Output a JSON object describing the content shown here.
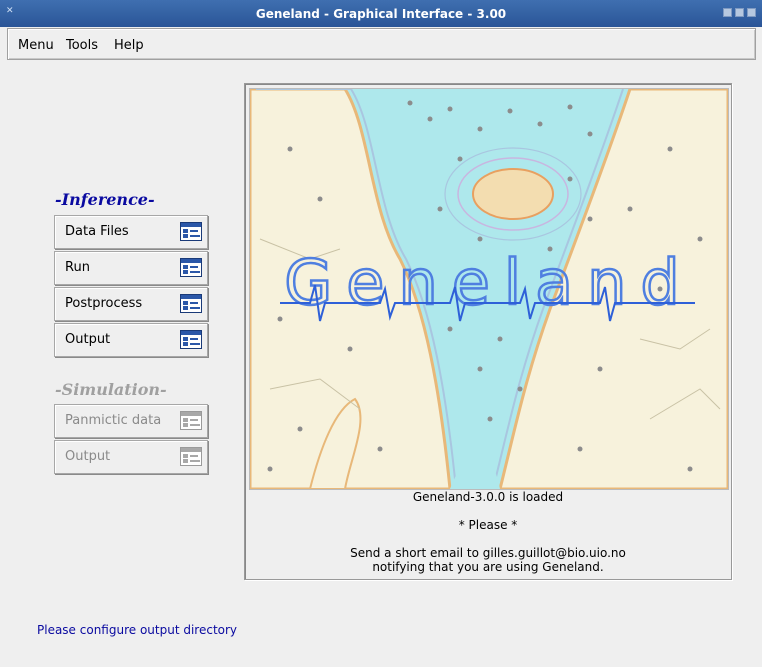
{
  "window": {
    "title": "Geneland - Graphical Interface - 3.00"
  },
  "menubar": {
    "items": [
      "Menu",
      "Tools",
      "Help"
    ]
  },
  "inference": {
    "title": "-Inference-",
    "buttons": [
      "Data Files",
      "Run",
      "Postprocess",
      "Output"
    ]
  },
  "simulation": {
    "title": "-Simulation-",
    "buttons": [
      "Panmictic data",
      "Output"
    ]
  },
  "logo": {
    "text": "Geneland"
  },
  "messages": {
    "loaded": "Geneland-3.0.0 is loaded",
    "please": "* Please *",
    "email_line": "Send a short email to gilles.guillot@bio.uio.no",
    "notify_line": "notifying that you are using Geneland."
  },
  "status": {
    "text": "Please configure output directory"
  },
  "colors": {
    "accent_blue": "#0a0aa0",
    "title_bar": "#2f5ea2",
    "water": "#aee8ec",
    "land": "#f7f2dc"
  }
}
